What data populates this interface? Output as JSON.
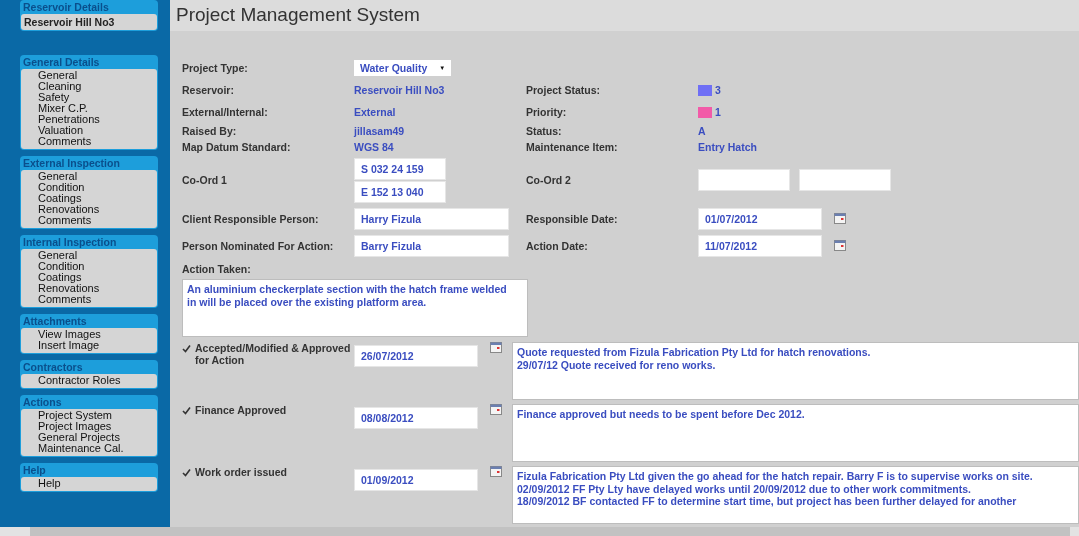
{
  "sidebar": {
    "top_header": "Reservoir Details",
    "reservoir": "Reservoir Hill No3",
    "sections": [
      {
        "title": "General Details",
        "items": [
          "General",
          "Cleaning",
          "Safety",
          "Mixer C.P.",
          "Penetrations",
          "Valuation",
          "Comments"
        ]
      },
      {
        "title": "External Inspection",
        "items": [
          "General",
          "Condition",
          "Coatings",
          "Renovations",
          "Comments"
        ]
      },
      {
        "title": "Internal Inspection",
        "items": [
          "General",
          "Condition",
          "Coatings",
          "Renovations",
          "Comments"
        ]
      },
      {
        "title": "Attachments",
        "items": [
          "View Images",
          "Insert Image"
        ]
      },
      {
        "title": "Contractors",
        "items": [
          "Contractor Roles"
        ]
      },
      {
        "title": "Actions",
        "items": [
          "Project System",
          "Project Images",
          "General Projects",
          "Maintenance Cal."
        ]
      },
      {
        "title": "Help",
        "items": [
          "Help"
        ]
      }
    ]
  },
  "title": "Project Management System",
  "project_type": {
    "label": "Project Type:",
    "value": "Water Quality",
    "caret": "▼"
  },
  "info_rows": [
    {
      "left": {
        "label": "Reservoir:",
        "value": "Reservoir Hill No3"
      },
      "right": {
        "label": "Project Status:",
        "value": "3",
        "color": "#6f6ff5"
      }
    },
    {
      "left": {
        "label": "External/Internal:",
        "value": "External"
      },
      "right": {
        "label": "Priority:",
        "value": "1",
        "color": "#f25aa8"
      }
    },
    {
      "left": {
        "label": "Raised By:",
        "value": "jillasam49"
      },
      "right": {
        "label": "Status:",
        "value": "A"
      }
    },
    {
      "left": {
        "label": "Map Datum Standard:",
        "value": "WGS 84"
      },
      "right": {
        "label": "Maintenance Item:",
        "value": "Entry Hatch"
      }
    }
  ],
  "coords": {
    "label_1": "Co-Ord 1",
    "values_1": [
      "S 032 24 159",
      "E 152 13 040"
    ],
    "label_2": "Co-Ord 2"
  },
  "person_rows": [
    {
      "label": "Client Responsible Person:",
      "value": "Harry Fizula",
      "date_label": "Responsible Date:",
      "date": "01/07/2012"
    },
    {
      "label": "Person Nominated For Action:",
      "value": "Barry Fizula",
      "date_label": "Action Date:",
      "date": "11/07/2012"
    }
  ],
  "action_taken": {
    "label": "Action Taken:",
    "value": "An aluminium checkerplate section with the hatch frame welded\nin will be placed over the existing platform area."
  },
  "steps": [
    {
      "label": "Accepted/Modified & Approved for Action",
      "checked": true,
      "date": "26/07/2012",
      "notes": "Quote requested from Fizula Fabrication Pty Ltd for hatch renovations.\n29/07/12 Quote received for reno works."
    },
    {
      "label": "Finance Approved",
      "checked": true,
      "date": "08/08/2012",
      "notes": "Finance approved but needs to be spent before Dec 2012."
    },
    {
      "label": "Work order issued",
      "checked": true,
      "date": "01/09/2012",
      "notes": "Fizula Fabrication Pty Ltd given the go ahead for the hatch repair. Barry F is to supervise works on site.\n02/09/2012 FF Pty Lty have delayed works until 20/09/2012 due to other work commitments.\n18/09/2012 BF contacted FF to determine start time, but project has been further delayed for another"
    }
  ]
}
